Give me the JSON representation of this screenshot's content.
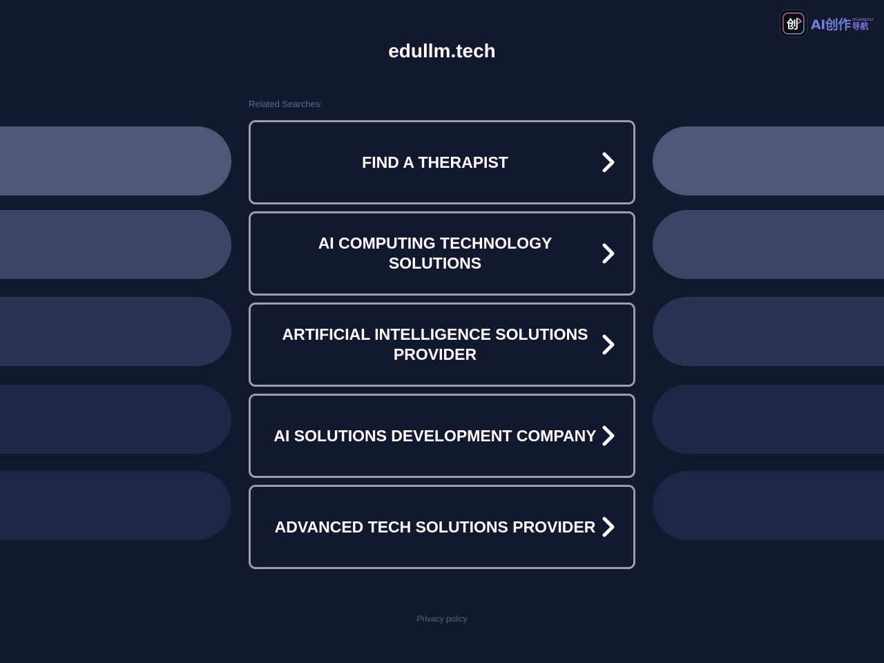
{
  "logo": {
    "icon": "chuang-logo-icon",
    "glyph": "创",
    "main": "AI创作",
    "small": "chuangzuo",
    "sub": "导航"
  },
  "site": {
    "title": "edullm.tech"
  },
  "related": {
    "label": "Related Searches:",
    "links": [
      {
        "label": "FIND A THERAPIST"
      },
      {
        "label": "AI COMPUTING TECHNOLOGY SOLUTIONS"
      },
      {
        "label": "ARTIFICIAL INTELLIGENCE SOLUTIONS PROVIDER"
      },
      {
        "label": "AI SOLUTIONS DEVELOPMENT COMPANY"
      },
      {
        "label": "ADVANCED TECH SOLUTIONS PROVIDER"
      }
    ],
    "icon": "chevron-right-icon"
  },
  "footer": {
    "privacy": "Privacy policy"
  },
  "colors": {
    "background": "#12182e",
    "border": "#9a9ea6",
    "accent": "#6f7fd8"
  }
}
